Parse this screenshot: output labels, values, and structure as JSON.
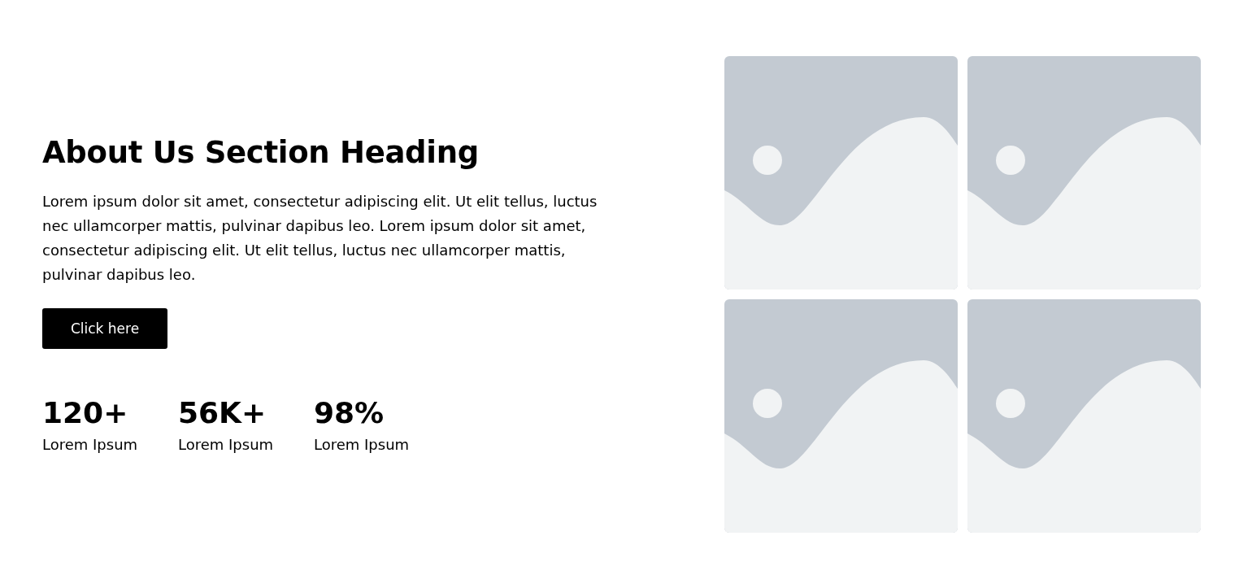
{
  "heading": "About Us Section Heading",
  "paragraph": "Lorem ipsum dolor sit amet, consectetur adipiscing elit. Ut elit tellus, luctus nec ullamcorper mattis, pulvinar dapibus leo. Lorem ipsum dolor sit amet, consectetur adipiscing elit. Ut elit tellus, luctus nec ullamcorper mattis, pulvinar dapibus leo.",
  "button": "Click here",
  "stats": [
    {
      "value": "120+",
      "label": "Lorem Ipsum"
    },
    {
      "value": "56K+",
      "label": "Lorem Ipsum"
    },
    {
      "value": "98%",
      "label": "Lorem Ipsum"
    }
  ]
}
